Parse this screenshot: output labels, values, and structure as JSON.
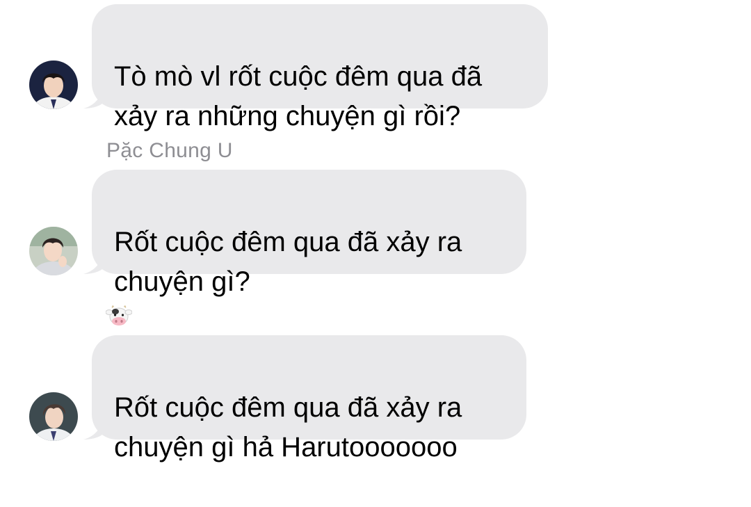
{
  "messages": [
    {
      "sender_label": "",
      "avatar": "avatar-boy-school-uniform-dark",
      "text": "Tò mò vl rốt cuộc đêm qua đã\nxảy ra những chuyện gì rồi?"
    },
    {
      "sender_label": "Pặc Chung U",
      "avatar": "avatar-boy-light-sweater",
      "text": "Rốt cuộc đêm qua đã xảy ra\nchuyện gì?"
    },
    {
      "sender_label": "",
      "sender_icon": "cow-face-emoji",
      "avatar": "avatar-boy-school-uniform",
      "text": "Rốt cuộc đêm qua đã xảy ra\nchuyện gì hả Harutooooooo"
    }
  ],
  "colors": {
    "bubble": "#e9e9eb",
    "sender_name": "#8e8e93",
    "text": "#000000",
    "background": "#ffffff"
  }
}
